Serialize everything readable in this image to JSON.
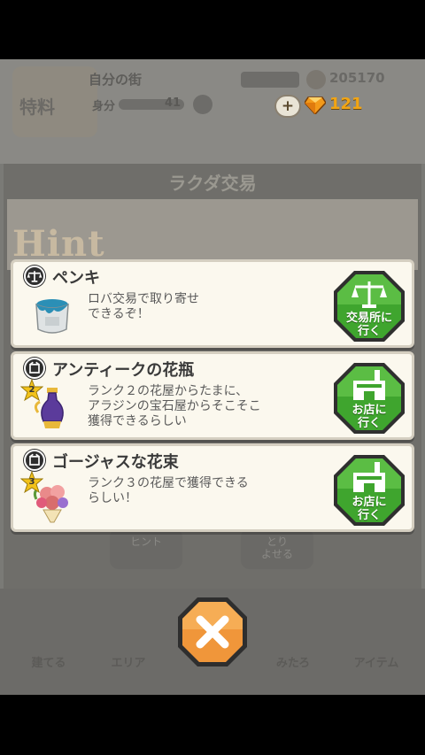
{
  "header": {
    "logo_text": "特料",
    "town_name": "自分の街",
    "rank_label": "身分",
    "rank_value": "41",
    "coins": "205170",
    "gems": "121"
  },
  "panel": {
    "title": "ラクダ交易",
    "hint_heading": "Hint"
  },
  "hints": [
    {
      "title": "ペンキ",
      "description": "ロバ交易で取り寄せ\nできるぞ！",
      "button_label": "交易所に\n行く",
      "icon": "scale-icon",
      "item_icon": "paint-bucket-icon"
    },
    {
      "title": "アンティークの花瓶",
      "description": "ランク２の花屋からたまに、\nアラジンの宝石屋からそこそこ\n獲得できるらしい",
      "button_label": "お店に\n行く",
      "rank_badge": "2",
      "icon": "box-icon",
      "item_icon": "vase-icon"
    },
    {
      "title": "ゴージャスな花束",
      "description": "ランク３の花屋で獲得できる\nらしい！",
      "button_label": "お店に\n行く",
      "rank_badge": "3",
      "icon": "box-icon",
      "item_icon": "bouquet-icon"
    }
  ],
  "background_buttons": {
    "hint": "ヒント",
    "order": "とり\nよせる"
  },
  "bottom_nav": [
    "建てる",
    "エリア",
    "みたろ",
    "アイテム"
  ],
  "colors": {
    "go_button_green": "#3fa52e",
    "close_button_orange": "#f0963a",
    "gem_orange": "#f2a514"
  }
}
